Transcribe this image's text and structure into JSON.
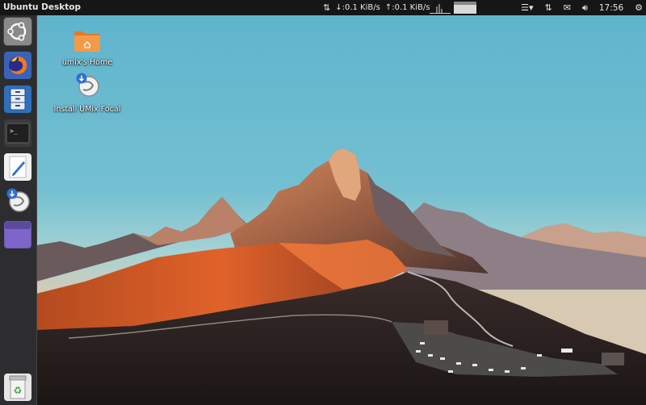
{
  "top_panel": {
    "title": "Ubuntu Desktop",
    "netspeed": {
      "down": "↓:0.1 KiB/s",
      "up": "↑:0.1 KiB/s"
    },
    "clock": "17:56"
  },
  "launcher": {
    "items": [
      {
        "name": "ubuntu-dash-icon"
      },
      {
        "name": "firefox-icon"
      },
      {
        "name": "file-manager-icon"
      },
      {
        "name": "terminal-icon"
      },
      {
        "name": "text-editor-icon"
      },
      {
        "name": "installer-icon"
      },
      {
        "name": "workspace-switcher-icon"
      },
      {
        "name": "trash-icon"
      }
    ]
  },
  "desktop": {
    "icons": [
      {
        "label": "umix's Home"
      },
      {
        "label": "Install UMix Focal"
      }
    ]
  },
  "colors": {
    "panel": "#161616",
    "folder": "#f08c3c",
    "installer_badge": "#2f6fd6"
  }
}
